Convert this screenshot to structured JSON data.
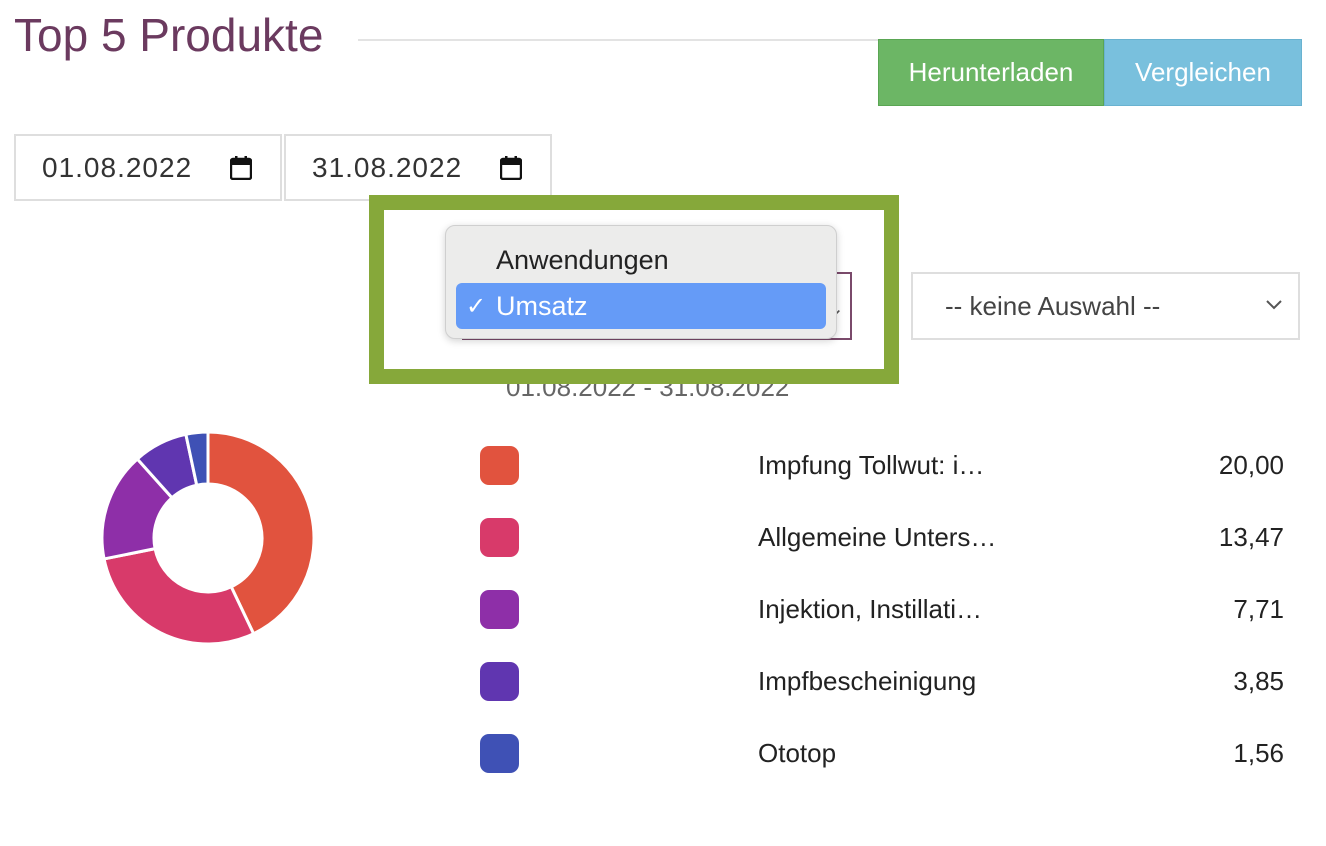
{
  "title": "Top 5 Produkte",
  "buttons": {
    "download": "Herunterladen",
    "compare": "Vergleichen"
  },
  "dates": {
    "from": "01.08.2022",
    "to": "31.08.2022"
  },
  "metric_dropdown": {
    "options": [
      {
        "label": "Anwendungen",
        "selected": false
      },
      {
        "label": "Umsatz",
        "selected": true
      }
    ],
    "check": "✓"
  },
  "filter_select": {
    "value": "-- keine Auswahl --"
  },
  "range_label": "01.08.2022 - 31.08.2022",
  "colors": {
    "title": "#6b3a5f",
    "download": "#6cb665",
    "compare": "#79c0dd",
    "highlight": "#86a83a",
    "selected_option": "#659bf7"
  },
  "chart_data": {
    "type": "pie",
    "donut": true,
    "series": [
      {
        "name": "Impfung Tollwut: i…",
        "value": 20.0,
        "display": "20,00",
        "color": "#e1533e"
      },
      {
        "name": "Allgemeine Unters…",
        "value": 13.47,
        "display": "13,47",
        "color": "#d83a6a"
      },
      {
        "name": "Injektion, Instillati…",
        "value": 7.71,
        "display": "7,71",
        "color": "#8e2fa8"
      },
      {
        "name": "Impfbescheinigung",
        "value": 3.85,
        "display": "3,85",
        "color": "#6036b0"
      },
      {
        "name": "Ototop",
        "value": 1.56,
        "display": "1,56",
        "color": "#3f51b5"
      }
    ]
  }
}
